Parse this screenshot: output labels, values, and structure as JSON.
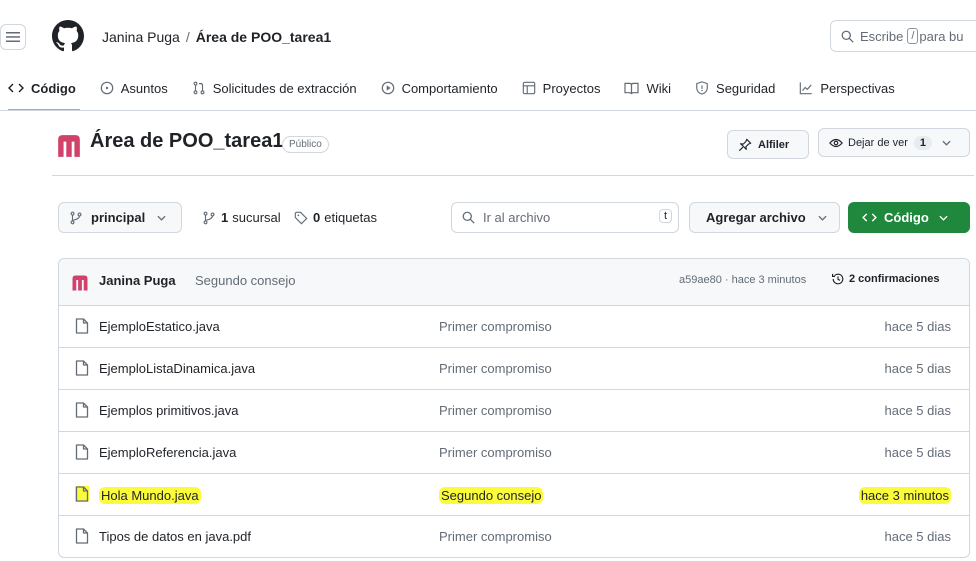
{
  "header": {
    "owner": "Janina Puga",
    "separator": "/",
    "repo": "Área de POO_tarea1",
    "search_prefix": "Escribe",
    "search_key": "/",
    "search_suffix": "para bu"
  },
  "nav": {
    "items": [
      {
        "label": "Código",
        "icon": "code-icon"
      },
      {
        "label": "Asuntos",
        "icon": "issue-icon"
      },
      {
        "label": "Solicitudes de extracción",
        "icon": "pull-request-icon"
      },
      {
        "label": "Comportamiento",
        "icon": "play-icon"
      },
      {
        "label": "Proyectos",
        "icon": "table-icon"
      },
      {
        "label": "Wiki",
        "icon": "book-icon"
      },
      {
        "label": "Seguridad",
        "icon": "shield-icon"
      },
      {
        "label": "Perspectivas",
        "icon": "graph-icon"
      }
    ]
  },
  "repo": {
    "title": "Área de POO_tarea1",
    "visibility": "Público",
    "pin_label": "Alfiler",
    "watch_label": "Dejar de ver",
    "watch_count": "1"
  },
  "branch_bar": {
    "branch": "principal",
    "branches_count": "1",
    "branches_label": "sucursal",
    "tags_count": "0",
    "tags_label": "etiquetas",
    "goto_placeholder": "Ir al archivo",
    "goto_key": "t",
    "add_file_label": "Agregar archivo",
    "code_label": "Código"
  },
  "latest_commit": {
    "author": "Janina Puga",
    "message": "Segundo consejo",
    "sha_time": "a59ae80 · hace 3 minutos",
    "commits_label": "2 confirmaciones"
  },
  "files": [
    {
      "name": "EjemploEstatico.java",
      "message": "Primer compromiso",
      "date": "hace 5 dias"
    },
    {
      "name": "EjemploListaDinamica.java",
      "message": "Primer compromiso",
      "date": "hace 5 dias"
    },
    {
      "name": "Ejemplos primitivos.java",
      "message": "Primer compromiso",
      "date": "hace 5 dias"
    },
    {
      "name": "EjemploReferencia.java",
      "message": "Primer compromiso",
      "date": "hace 5 dias"
    },
    {
      "name": "Hola Mundo.java",
      "message": "Segundo consejo",
      "date": "hace 3 minutos",
      "highlight": "#fbfb3b"
    },
    {
      "name": "Tipos de datos en java.pdf",
      "message": "Primer compromiso",
      "date": "hace 5 dias"
    }
  ],
  "colors": {
    "accent_green": "#1f883d",
    "nav_underline": "#fd8c73",
    "avatar": "#d1426b",
    "highlight": "#fbfb3b"
  }
}
